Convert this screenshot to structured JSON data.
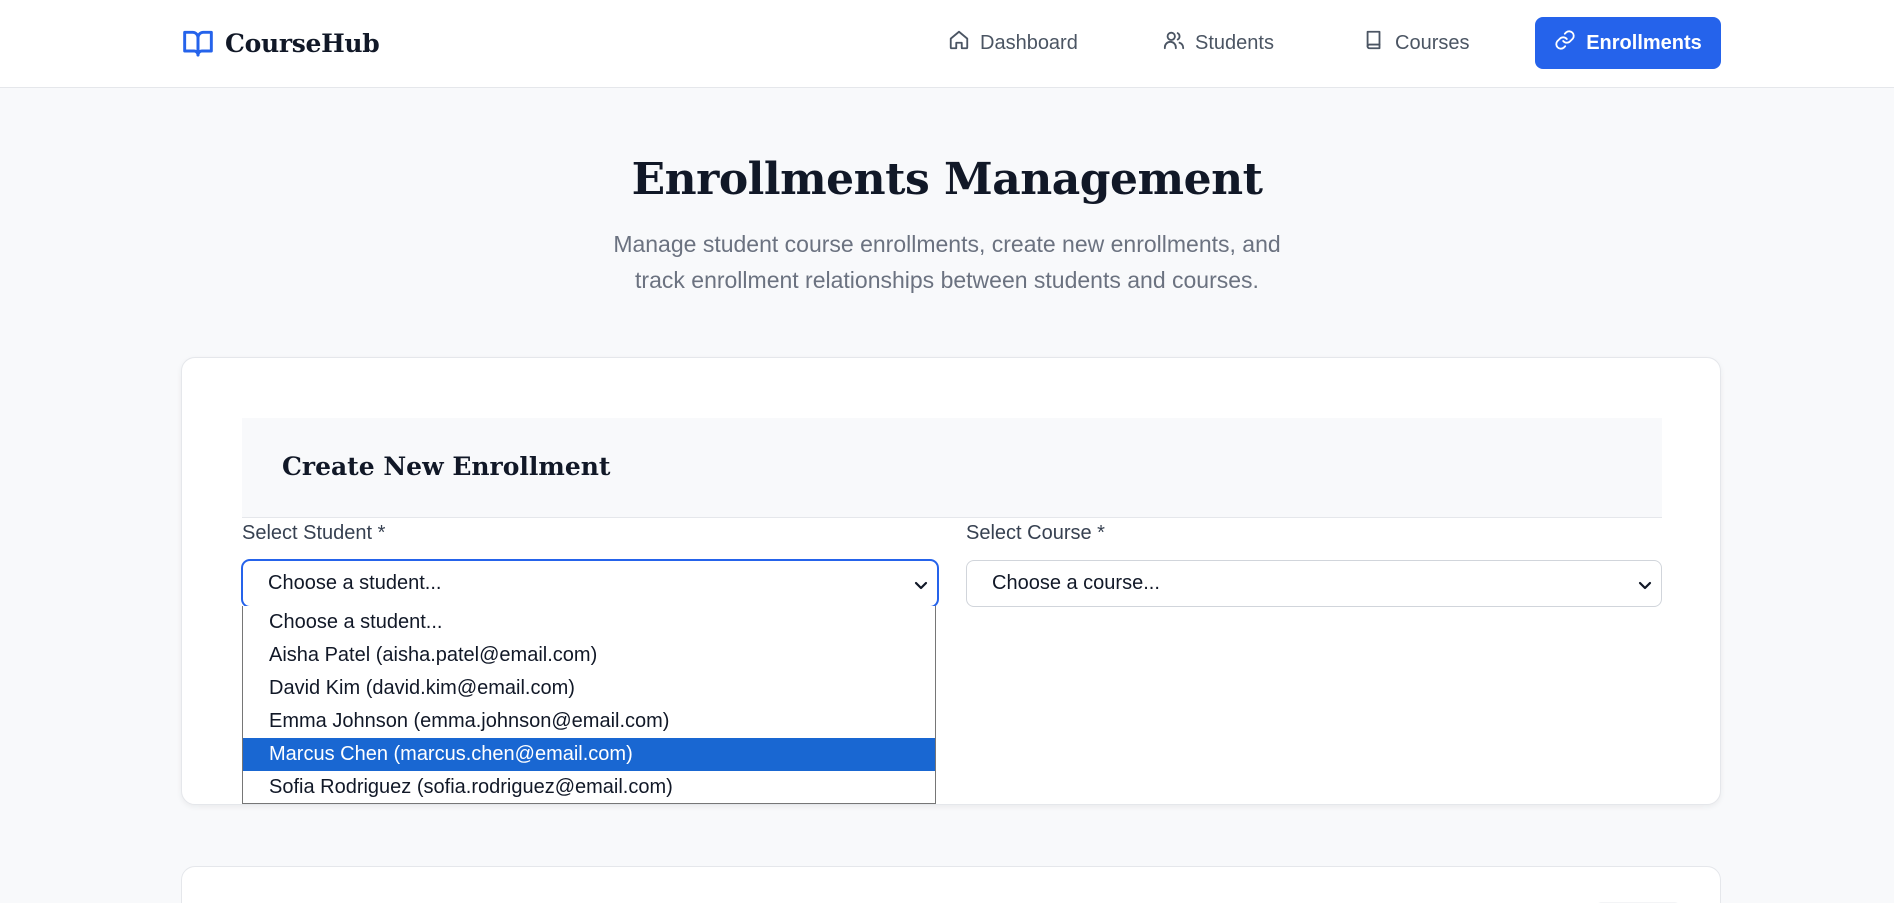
{
  "app": {
    "brand": "CourseHub"
  },
  "nav": {
    "items": [
      {
        "label": "Dashboard",
        "icon": "home-icon"
      },
      {
        "label": "Students",
        "icon": "users-icon"
      },
      {
        "label": "Courses",
        "icon": "book-icon"
      },
      {
        "label": "Enrollments",
        "icon": "link-icon",
        "active": true
      }
    ]
  },
  "hero": {
    "title": "Enrollments Management",
    "subtitle": "Manage student course enrollments, create new enrollments, and track enrollment relationships between students and courses."
  },
  "form": {
    "title": "Create New Enrollment",
    "student_label": "Select Student *",
    "student_value": "Choose a student...",
    "course_label": "Select Course *",
    "course_value": "Choose a course...",
    "student_options": [
      "Choose a student...",
      "Aisha Patel (aisha.patel@email.com)",
      "David Kim (david.kim@email.com)",
      "Emma Johnson (emma.johnson@email.com)",
      "Marcus Chen (marcus.chen@email.com)",
      "Sofia Rodriguez (sofia.rodriguez@email.com)"
    ],
    "highlighted_option": "Marcus Chen (marcus.chen@email.com)"
  },
  "colors": {
    "accent": "#2563eb",
    "option_highlight": "#1967d2",
    "background": "#f8f9fb"
  }
}
